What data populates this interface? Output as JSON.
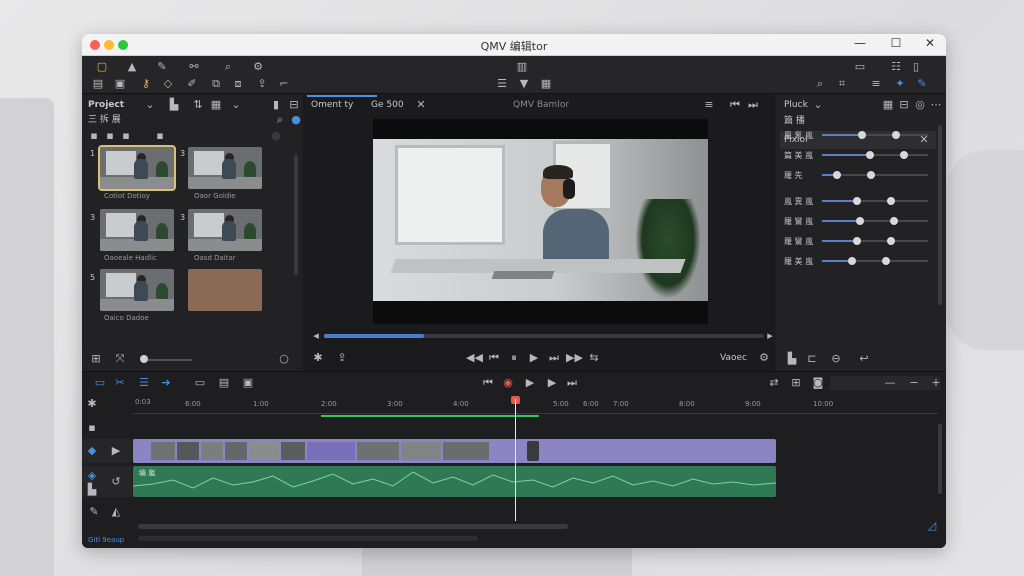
{
  "window": {
    "title": "QMV 编辑tor"
  },
  "toolbar": {
    "center_icon": "film-strip-icon"
  },
  "project_panel": {
    "title": "Project",
    "subtitle": "三 拆 展",
    "clips": [
      {
        "num": "1",
        "label": "Cotiot Dotioy"
      },
      {
        "num": "3",
        "label": "Oaor Goldie"
      },
      {
        "num": "3",
        "label": "Oaoeale Hadlic"
      },
      {
        "num": "3",
        "label": "Oasd Daitar"
      },
      {
        "num": "5",
        "label": "Oaico Dadoe"
      }
    ]
  },
  "viewer": {
    "tab1": "Oment ty",
    "tab2": "Ge 500",
    "tab3": "QMV Bamlor",
    "label": "Vaoec"
  },
  "right_panel": {
    "title": "Pluck",
    "subtitle": "篇 播",
    "section": "Pixiol",
    "sliders": [
      {
        "label": "鳳 氪 嵐",
        "value": 0.38
      },
      {
        "label": "篇 美 嵐",
        "value": 0.45
      },
      {
        "label": "羅 先",
        "value": 0.14
      },
      {
        "label": "嵐 異 嵐",
        "value": 0.33
      },
      {
        "label": "羅 鸞 嵐",
        "value": 0.36
      },
      {
        "label": "羅 鸞 嵐",
        "value": 0.33
      },
      {
        "label": "羅 美 嵐",
        "value": 0.28
      }
    ]
  },
  "timeline": {
    "ruler": [
      "0:03",
      "6:00",
      "1:00",
      "2:00",
      "3:00",
      "4:00",
      "5:00",
      "6:00",
      "7:00",
      "8:00",
      "9:00",
      "10:00"
    ],
    "audio_label": "编 嵐",
    "status": "Gitl 9eaup"
  }
}
